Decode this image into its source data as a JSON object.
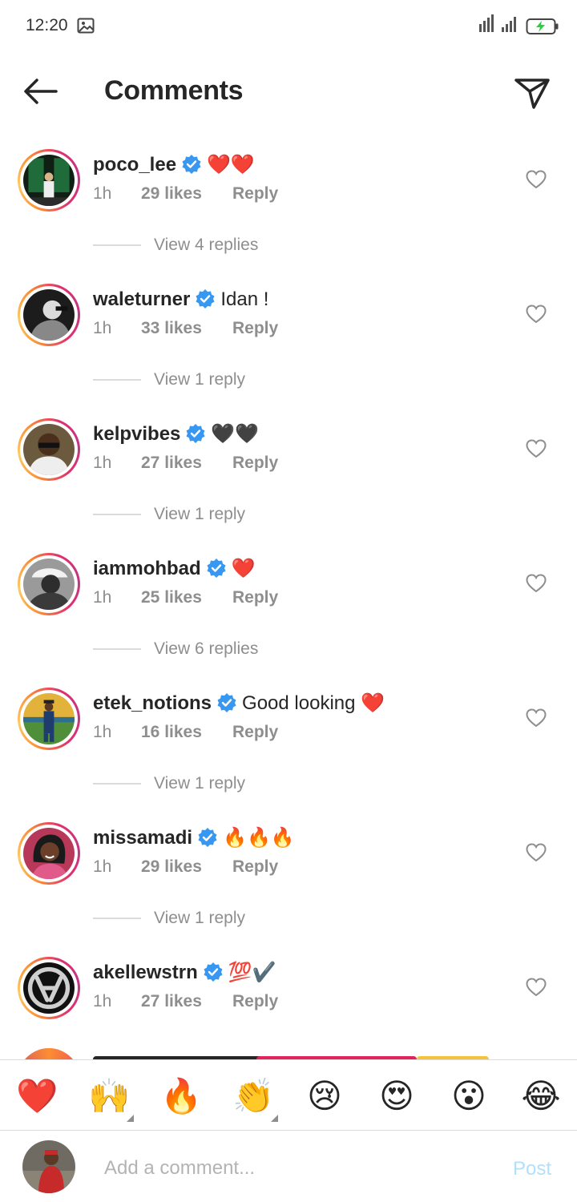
{
  "status_bar": {
    "time": "12:20",
    "icons": [
      "gallery-icon",
      "signal-icon",
      "battery-charging-icon"
    ]
  },
  "header": {
    "title": "Comments",
    "icons": [
      "back-arrow-icon",
      "send-icon"
    ]
  },
  "colors": {
    "verified": "#3897f0",
    "post_inactive": "#b2dffc",
    "meta_text": "#8e8e8e"
  },
  "comments": [
    {
      "username": "poco_lee",
      "text": "❤️❤️",
      "time": "1h",
      "likes": "29 likes",
      "reply": "Reply",
      "view_replies": "View 4 replies"
    },
    {
      "username": "waleturner",
      "text": "Idan !",
      "time": "1h",
      "likes": "33 likes",
      "reply": "Reply",
      "view_replies": "View 1 reply"
    },
    {
      "username": "kelpvibes",
      "text": "🖤🖤",
      "time": "1h",
      "likes": "27 likes",
      "reply": "Reply",
      "view_replies": "View 1 reply"
    },
    {
      "username": "iammohbad",
      "text": "❤️",
      "time": "1h",
      "likes": "25 likes",
      "reply": "Reply",
      "view_replies": "View 6 replies"
    },
    {
      "username": "etek_notions",
      "text": "Good looking ❤️",
      "time": "1h",
      "likes": "16 likes",
      "reply": "Reply",
      "view_replies": "View 1 reply"
    },
    {
      "username": "missamadi",
      "text": "🔥🔥🔥",
      "time": "1h",
      "likes": "29 likes",
      "reply": "Reply",
      "view_replies": "View 1 reply"
    },
    {
      "username": "akellewstrn",
      "text": "💯✔️",
      "time": "1h",
      "likes": "27 likes",
      "reply": "Reply",
      "view_replies": ""
    }
  ],
  "emoji_bar": [
    "❤️",
    "🙌",
    "🔥",
    "👏",
    "😢",
    "😍",
    "😮",
    "😂"
  ],
  "composer": {
    "placeholder": "Add a comment...",
    "post_label": "Post"
  }
}
